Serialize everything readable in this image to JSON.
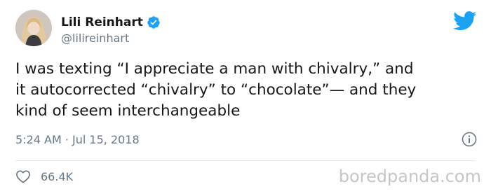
{
  "author": {
    "display_name": "Lili Reinhart",
    "handle": "@lilireinhart",
    "verified": true
  },
  "tweet": {
    "lines": [
      "I was texting “I appreciate a man with chivalry,” and",
      "it autocorrected “chivalry” to “chocolate”— and they",
      "kind of seem interchangeable"
    ],
    "timestamp": "5:24 AM · Jul 15, 2018"
  },
  "engagement": {
    "likes": "66.4K"
  },
  "watermark": "boredpanda.com",
  "colors": {
    "twitter_blue": "#1da1f2",
    "text_primary": "#14171a",
    "text_secondary": "#657786",
    "divider": "#e1e8ed",
    "watermark": "#c5c5c5"
  },
  "icons": {
    "verified": "verified-badge-icon",
    "brand": "twitter-bird-icon",
    "info": "info-icon",
    "like": "heart-icon"
  }
}
